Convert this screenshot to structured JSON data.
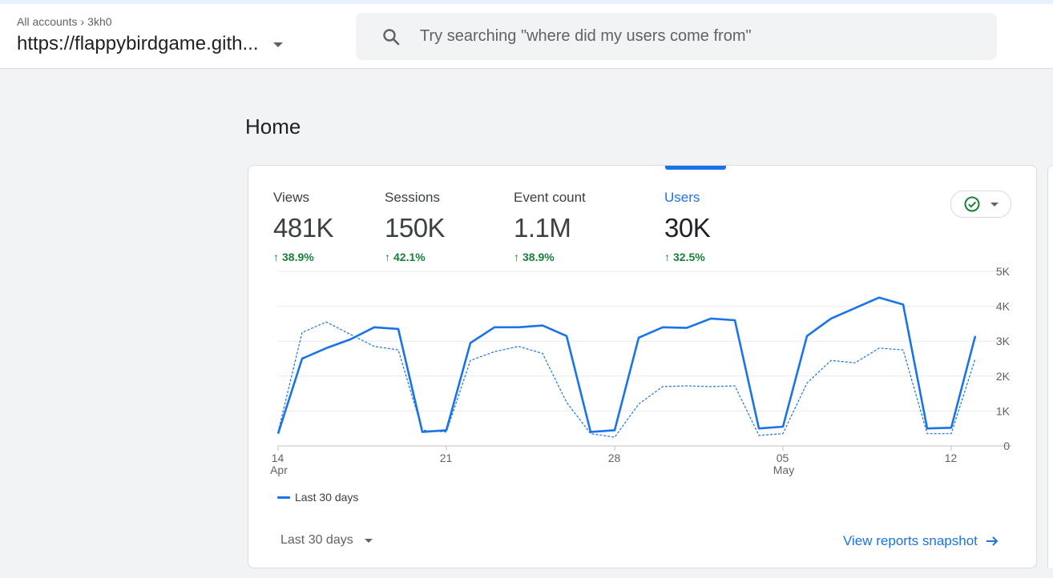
{
  "breadcrumb": {
    "root": "All accounts",
    "account": "3kh0"
  },
  "property": {
    "name": "https://flappybirdgame.gith..."
  },
  "search": {
    "placeholder": "Try searching \"where did my users come from\""
  },
  "page": {
    "title": "Home"
  },
  "metrics": [
    {
      "label": "Views",
      "value": "481K",
      "change": "38.9%"
    },
    {
      "label": "Sessions",
      "value": "150K",
      "change": "42.1%"
    },
    {
      "label": "Event count",
      "value": "1.1M",
      "change": "38.9%"
    },
    {
      "label": "Users",
      "value": "30K",
      "change": "32.5%"
    }
  ],
  "active_metric": "Users",
  "colors": {
    "accent": "#1a73e8",
    "positive": "#188038",
    "check": "#188038"
  },
  "icons": {
    "search": "search-icon",
    "compare": "check-circle-icon",
    "arrow": "arrow-right-icon"
  },
  "chart_data": {
    "type": "line",
    "x": [
      "Apr 14",
      "Apr 15",
      "Apr 16",
      "Apr 17",
      "Apr 18",
      "Apr 19",
      "Apr 20",
      "Apr 21",
      "Apr 22",
      "Apr 23",
      "Apr 24",
      "Apr 25",
      "Apr 26",
      "Apr 27",
      "Apr 28",
      "Apr 29",
      "Apr 30",
      "May 1",
      "May 2",
      "May 3",
      "May 4",
      "May 5",
      "May 6",
      "May 7",
      "May 8",
      "May 9",
      "May 10",
      "May 11",
      "May 12",
      "May 13"
    ],
    "x_ticks": [
      {
        "index": 0,
        "day": "14",
        "month": "Apr"
      },
      {
        "index": 7,
        "day": "21",
        "month": ""
      },
      {
        "index": 14,
        "day": "28",
        "month": ""
      },
      {
        "index": 21,
        "day": "05",
        "month": "May"
      },
      {
        "index": 28,
        "day": "12",
        "month": ""
      }
    ],
    "y_ticks": [
      "0",
      "1K",
      "2K",
      "3K",
      "4K",
      "5K"
    ],
    "ylim": [
      0,
      5000
    ],
    "series": [
      {
        "name": "Last 30 days",
        "style": "solid",
        "values": [
          350,
          2500,
          2800,
          3050,
          3400,
          3350,
          400,
          450,
          2950,
          3400,
          3400,
          3450,
          3150,
          400,
          450,
          3100,
          3400,
          3380,
          3650,
          3600,
          500,
          550,
          3150,
          3650,
          3950,
          4250,
          4050,
          500,
          520,
          3150
        ]
      },
      {
        "values": [
          400,
          3250,
          3550,
          3200,
          2850,
          2750,
          450,
          400,
          2450,
          2700,
          2850,
          2650,
          1250,
          350,
          250,
          1200,
          1700,
          1720,
          1700,
          1720,
          300,
          350,
          1800,
          2450,
          2380,
          2800,
          2750,
          350,
          350,
          2500
        ]
      }
    ],
    "grid": true
  },
  "legend": {
    "label": "Last 30 days"
  },
  "footer": {
    "range_label": "Last 30 days",
    "snapshot_label": "View reports snapshot"
  }
}
